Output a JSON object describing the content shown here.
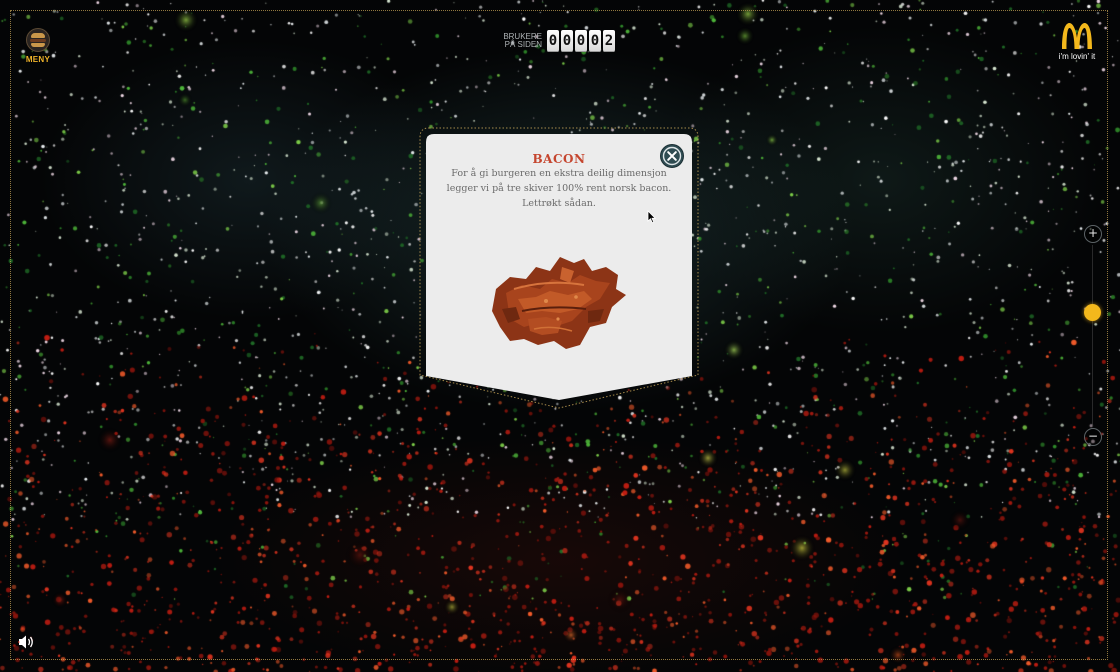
{
  "menu": {
    "label": "MENY",
    "icon": "burger-menu-icon"
  },
  "counter": {
    "label_line1": "BRUKERE",
    "label_line2": "PÅ SIDEN",
    "digits": [
      "0",
      "0",
      "0",
      "0",
      "2"
    ]
  },
  "logo": {
    "icon": "golden-arches-logo",
    "tagline": "i'm lovin' it",
    "color": "#f3b81c"
  },
  "zoom": {
    "plus_label": "+",
    "minus_label": "−",
    "level": 0.33
  },
  "sound": {
    "icon": "speaker-icon"
  },
  "popup": {
    "title": "BACON",
    "description": "For å gi burgeren en ekstra deilig dimensjon legger vi på tre skiver 100% rent norsk bacon. Lettrøkt sådan.",
    "close_icon": "close-x-icon",
    "image": "bacon-image",
    "title_color": "#c5462f"
  },
  "colors": {
    "accent": "#f3b81c",
    "background": "#040506",
    "close_button": "#2f4c52"
  }
}
